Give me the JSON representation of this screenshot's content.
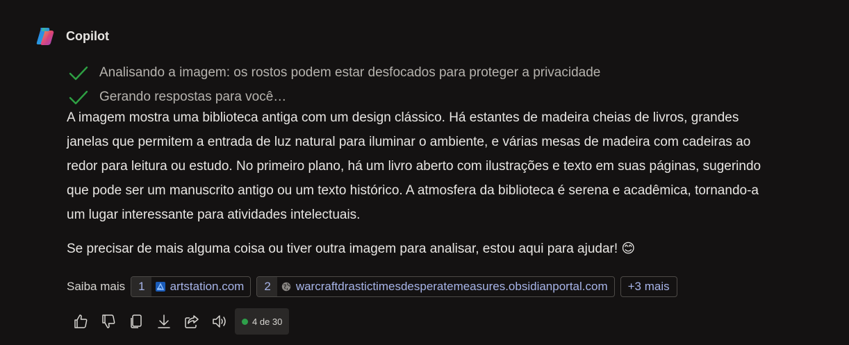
{
  "header": {
    "name": "Copilot",
    "logo_icon": "copilot-logo"
  },
  "steps": [
    {
      "icon": "check-icon",
      "text": "Analisando a imagem: os rostos podem estar desfocados para proteger a privacidade"
    },
    {
      "icon": "check-icon",
      "text": "Gerando respostas para você…"
    }
  ],
  "response": {
    "paragraph1": "A imagem mostra uma biblioteca antiga com um design clássico. Há estantes de madeira cheias de livros, grandes janelas que permitem a entrada de luz natural para iluminar o ambiente, e várias mesas de madeira com cadeiras ao redor para leitura ou estudo. No primeiro plano, há um livro aberto com ilustrações e texto em suas páginas, sugerindo que pode ser um manuscrito antigo ou um texto histórico. A atmosfera da biblioteca é serena e acadêmica, tornando-a um lugar interessante para atividades intelectuais.",
    "paragraph2": "Se precisar de mais alguma coisa ou tiver outra imagem para analisar, estou aqui para ajudar! 😊"
  },
  "sources": {
    "label": "Saiba mais",
    "items": [
      {
        "num": "1",
        "icon": "artstation-icon",
        "text": "artstation.com"
      },
      {
        "num": "2",
        "icon": "globe-icon",
        "text": "warcraftdrastictimesdesperatemeasures.obsidianportal.com"
      }
    ],
    "more": "+3 mais"
  },
  "actions": {
    "icons": [
      "thumbs-up-icon",
      "thumbs-down-icon",
      "copy-icon",
      "download-icon",
      "share-icon",
      "speaker-icon"
    ],
    "counter": "4 de 30",
    "counter_dot_color": "#2e9f4a"
  },
  "colors": {
    "background": "#141212",
    "link": "#a7b4e8",
    "check": "#2ea043"
  }
}
